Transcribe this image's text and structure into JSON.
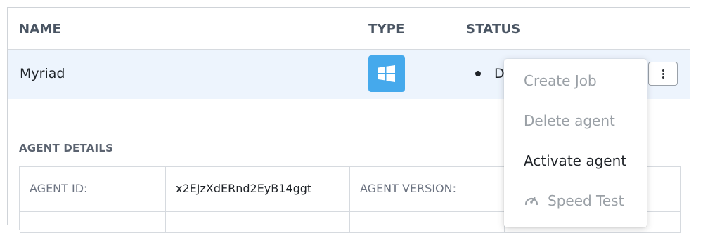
{
  "columns": {
    "name": "NAME",
    "type": "TYPE",
    "status": "STATUS"
  },
  "agent": {
    "name": "Myriad",
    "type_icon": "windows-icon",
    "status_text": "D",
    "status_dot_color": "#1f2328"
  },
  "details": {
    "title": "AGENT DETAILS",
    "agent_id_label": "AGENT ID:",
    "agent_id_value": "x2EJzXdERnd2EyB14ggt",
    "agent_version_label": "AGENT VERSION:"
  },
  "menu": {
    "items": [
      {
        "label": "Create Job",
        "enabled": false
      },
      {
        "label": "Delete agent",
        "enabled": false
      },
      {
        "label": "Activate agent",
        "enabled": true
      },
      {
        "label": "Speed Test",
        "enabled": false,
        "icon": "speedometer-icon"
      }
    ]
  },
  "colors": {
    "row_highlight": "#edf4fd",
    "windows_badge": "#45a9ec",
    "header_text": "#4a5563"
  }
}
